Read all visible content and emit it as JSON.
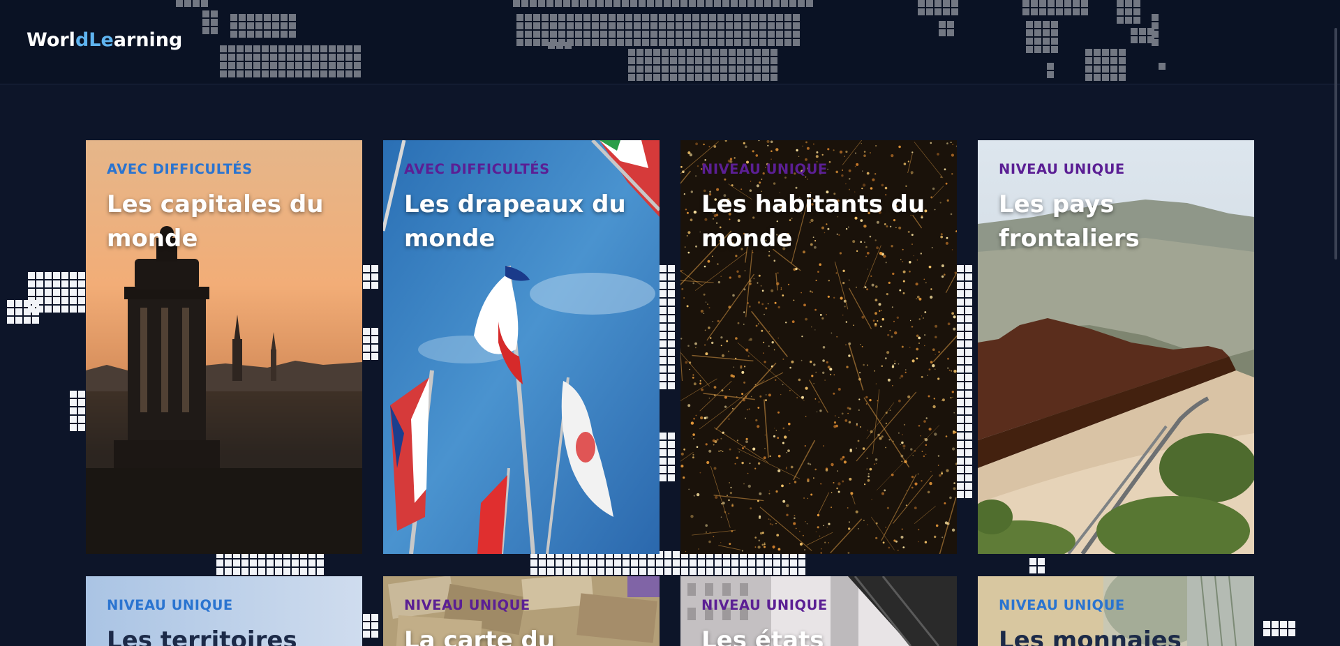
{
  "header": {
    "logo": {
      "part1": "Worl",
      "part2": "dLe",
      "part3": "arning"
    }
  },
  "colors": {
    "page_background": "#0d1529",
    "logo_accent": "#5fb4f0",
    "badge_blue": "#2a74d0",
    "badge_purple": "#5b1f94"
  },
  "cards": [
    {
      "badge": "AVEC DIFFICULTÉS",
      "title": "Les capitales du monde",
      "badge_color": "#2a74d0"
    },
    {
      "badge": "AVEC DIFFICULTÉS",
      "title": "Les drapeaux du monde",
      "badge_color": "#5b1f94"
    },
    {
      "badge": "NIVEAU UNIQUE",
      "title": "Les habitants du monde",
      "badge_color": "#5b1f94"
    },
    {
      "badge": "NIVEAU UNIQUE",
      "title": "Les pays frontaliers",
      "badge_color": "#5b1f94"
    },
    {
      "badge": "NIVEAU UNIQUE",
      "title": "Les territoires",
      "badge_color": "#2a74d0"
    },
    {
      "badge": "NIVEAU UNIQUE",
      "title": "La carte du",
      "badge_color": "#5b1f94"
    },
    {
      "badge": "NIVEAU UNIQUE",
      "title": "Les états",
      "badge_color": "#5b1f94"
    },
    {
      "badge": "NIVEAU UNIQUE",
      "title": "Les monnaies",
      "badge_color": "#2a74d0"
    }
  ]
}
